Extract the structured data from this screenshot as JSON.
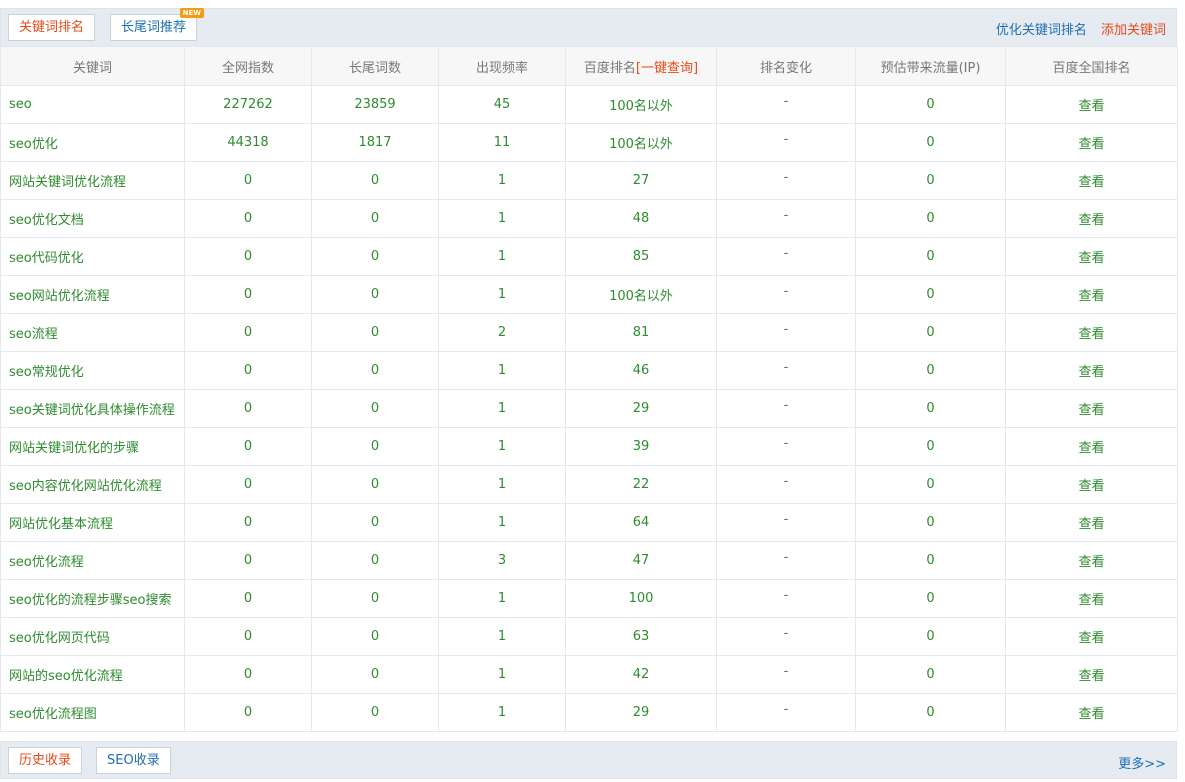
{
  "tabs": {
    "keyword_ranking": "关键词排名",
    "longtail_recommend": "长尾词推荐",
    "new_badge": "NEW"
  },
  "top_links": {
    "optimize": "优化关键词排名",
    "add": "添加关键词"
  },
  "table": {
    "headers": {
      "keyword": "关键词",
      "index": "全网指数",
      "longtail": "长尾词数",
      "frequency": "出现频率",
      "baidu_rank": "百度排名",
      "baidu_rank_link": "[一键查询]",
      "change": "排名变化",
      "traffic": "预估带来流量(IP)",
      "national": "百度全国排名"
    },
    "rows": [
      {
        "keyword": "seo",
        "index": "227262",
        "longtail": "23859",
        "frequency": "45",
        "rank": "100名以外",
        "change": "-",
        "traffic": "0",
        "view": "查看"
      },
      {
        "keyword": "seo优化",
        "index": "44318",
        "longtail": "1817",
        "frequency": "11",
        "rank": "100名以外",
        "change": "-",
        "traffic": "0",
        "view": "查看"
      },
      {
        "keyword": "网站关键词优化流程",
        "index": "0",
        "longtail": "0",
        "frequency": "1",
        "rank": "27",
        "change": "-",
        "traffic": "0",
        "view": "查看"
      },
      {
        "keyword": "seo优化文档",
        "index": "0",
        "longtail": "0",
        "frequency": "1",
        "rank": "48",
        "change": "-",
        "traffic": "0",
        "view": "查看"
      },
      {
        "keyword": "seo代码优化",
        "index": "0",
        "longtail": "0",
        "frequency": "1",
        "rank": "85",
        "change": "-",
        "traffic": "0",
        "view": "查看"
      },
      {
        "keyword": "seo网站优化流程",
        "index": "0",
        "longtail": "0",
        "frequency": "1",
        "rank": "100名以外",
        "change": "-",
        "traffic": "0",
        "view": "查看"
      },
      {
        "keyword": "seo流程",
        "index": "0",
        "longtail": "0",
        "frequency": "2",
        "rank": "81",
        "change": "-",
        "traffic": "0",
        "view": "查看"
      },
      {
        "keyword": "seo常规优化",
        "index": "0",
        "longtail": "0",
        "frequency": "1",
        "rank": "46",
        "change": "-",
        "traffic": "0",
        "view": "查看"
      },
      {
        "keyword": "seo关键词优化具体操作流程",
        "index": "0",
        "longtail": "0",
        "frequency": "1",
        "rank": "29",
        "change": "-",
        "traffic": "0",
        "view": "查看"
      },
      {
        "keyword": "网站关键词优化的步骤",
        "index": "0",
        "longtail": "0",
        "frequency": "1",
        "rank": "39",
        "change": "-",
        "traffic": "0",
        "view": "查看"
      },
      {
        "keyword": "seo内容优化网站优化流程",
        "index": "0",
        "longtail": "0",
        "frequency": "1",
        "rank": "22",
        "change": "-",
        "traffic": "0",
        "view": "查看"
      },
      {
        "keyword": "网站优化基本流程",
        "index": "0",
        "longtail": "0",
        "frequency": "1",
        "rank": "64",
        "change": "-",
        "traffic": "0",
        "view": "查看"
      },
      {
        "keyword": "seo优化流程",
        "index": "0",
        "longtail": "0",
        "frequency": "3",
        "rank": "47",
        "change": "-",
        "traffic": "0",
        "view": "查看"
      },
      {
        "keyword": "seo优化的流程步骤seo搜索",
        "index": "0",
        "longtail": "0",
        "frequency": "1",
        "rank": "100",
        "change": "-",
        "traffic": "0",
        "view": "查看"
      },
      {
        "keyword": "seo优化网页代码",
        "index": "0",
        "longtail": "0",
        "frequency": "1",
        "rank": "63",
        "change": "-",
        "traffic": "0",
        "view": "查看"
      },
      {
        "keyword": "网站的seo优化流程",
        "index": "0",
        "longtail": "0",
        "frequency": "1",
        "rank": "42",
        "change": "-",
        "traffic": "0",
        "view": "查看"
      },
      {
        "keyword": "seo优化流程图",
        "index": "0",
        "longtail": "0",
        "frequency": "1",
        "rank": "29",
        "change": "-",
        "traffic": "0",
        "view": "查看"
      }
    ]
  },
  "bottom": {
    "history": "历史收录",
    "seo": "SEO收录",
    "more": "更多>>"
  }
}
